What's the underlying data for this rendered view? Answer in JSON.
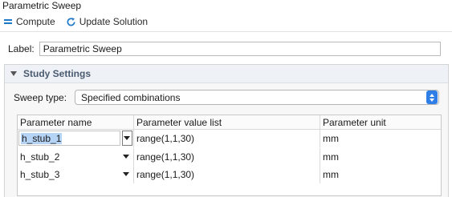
{
  "window": {
    "title": "Parametric Sweep"
  },
  "toolbar": {
    "compute_label": "Compute",
    "update_label": "Update Solution"
  },
  "label_field": {
    "label": "Label:",
    "value": "Parametric Sweep"
  },
  "section": {
    "title": "Study Settings",
    "sweep_type_label": "Sweep type:",
    "sweep_type_value": "Specified combinations"
  },
  "table": {
    "headers": [
      "Parameter name",
      "Parameter value list",
      "Parameter unit"
    ],
    "rows": [
      {
        "name": "h_stub_1",
        "values": "range(1,1,30)",
        "unit": "mm"
      },
      {
        "name": "h_stub_2",
        "values": "range(1,1,30)",
        "unit": "mm"
      },
      {
        "name": "h_stub_3",
        "values": "range(1,1,30)",
        "unit": "mm"
      }
    ]
  },
  "colors": {
    "accent": "#1f78c8",
    "section_title": "#4a5a70",
    "select_button": "#2f7de6",
    "selection": "#b5d3f5"
  },
  "icons": {
    "compute": "compute-icon",
    "update": "refresh-icon",
    "collapse": "triangle-down-icon"
  }
}
